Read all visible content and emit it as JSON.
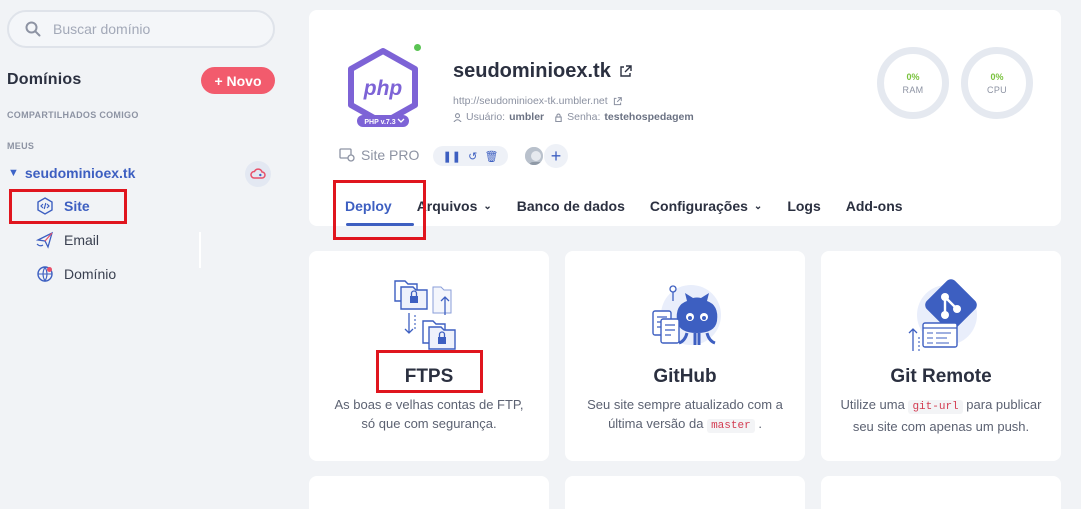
{
  "sidebar": {
    "search_placeholder": "Buscar domínio",
    "title": "Domínios",
    "new_button": "+ Novo",
    "shared_label": "COMPARTILHADOS COMIGO",
    "mine_label": "MEUS",
    "domain": {
      "name": "seudominioex.tk",
      "items": [
        {
          "label": "Site",
          "icon": "code-icon",
          "active": true
        },
        {
          "label": "Email",
          "icon": "paper-plane-icon",
          "active": false
        },
        {
          "label": "Domínio",
          "icon": "globe-icon",
          "active": false
        }
      ]
    }
  },
  "site": {
    "php_label": "php",
    "php_version": "PHP v.7.3",
    "title": "seudominioex.tk",
    "url": "http://seudominioex-tk.umbler.net",
    "user_label": "Usuário:",
    "user_value": "umbler",
    "password_label": "Senha:",
    "password_value": "testehospedagem",
    "ram": {
      "value": "0%",
      "label": "RAM"
    },
    "cpu": {
      "value": "0%",
      "label": "CPU"
    },
    "plan": "Site PRO"
  },
  "tabs": [
    {
      "label": "Deploy",
      "active": true,
      "dropdown": false
    },
    {
      "label": "Arquivos",
      "active": false,
      "dropdown": true
    },
    {
      "label": "Banco de dados",
      "active": false,
      "dropdown": false
    },
    {
      "label": "Configurações",
      "active": false,
      "dropdown": true
    },
    {
      "label": "Logs",
      "active": false,
      "dropdown": false
    },
    {
      "label": "Add-ons",
      "active": false,
      "dropdown": false
    }
  ],
  "cards": [
    {
      "title": "FTPS",
      "desc_line1": "As boas e velhas contas de FTP,",
      "desc_line2": "só que com segurança."
    },
    {
      "title": "GitHub",
      "desc_line1": "Seu site sempre atualizado com a",
      "desc_line2a": "última versão da",
      "code": "master",
      "desc_line2b": "."
    },
    {
      "title": "Git Remote",
      "desc_line1a": "Utilize uma",
      "code": "git-url",
      "desc_line1b": "para publicar",
      "desc_line2": "seu site com apenas um push."
    }
  ],
  "colors": {
    "accent": "#3d5fc1",
    "new_button": "#f25b6d",
    "highlight": "#e0151e",
    "gauge_value": "#79c23d"
  }
}
